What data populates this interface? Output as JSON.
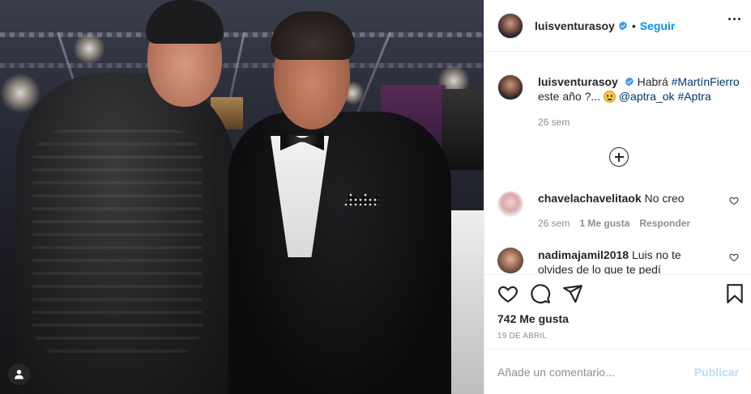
{
  "post": {
    "author": "luisventurasoy",
    "follow_label": "Seguir",
    "caption": {
      "username": "luisventurasoy",
      "text_before": "Habrá ",
      "hashtag1": "#MartínFierro",
      "text_middle": " este año ?... ",
      "mention": "@aptra_ok",
      "hashtag2": "#Aptra",
      "time": "26 sem"
    },
    "comments": [
      {
        "username": "chavelachavelitaok",
        "text": "No creo",
        "time": "26 sem",
        "likes": "1 Me gusta",
        "reply": "Responder"
      },
      {
        "username": "nadimajamil2018",
        "text": "Luis no te olvides de lo que te pedí",
        "time": "",
        "likes": "",
        "reply": ""
      }
    ],
    "likes_label": "742 Me gusta",
    "date": "19 DE ABRIL",
    "comment_placeholder": "Añade un comentario...",
    "publish_label": "Publicar"
  },
  "icons": {
    "verified": "verified-badge-icon",
    "more": "more-options-icon",
    "load_more": "add-circle-icon",
    "like": "heart-icon",
    "comment": "comment-icon",
    "share": "share-icon",
    "save": "bookmark-icon",
    "user_tag": "user-tag-icon"
  },
  "colors": {
    "accent": "#0095f6",
    "link": "#00376b",
    "muted": "#8e8e8e",
    "publish_disabled": "#b2dffc"
  }
}
